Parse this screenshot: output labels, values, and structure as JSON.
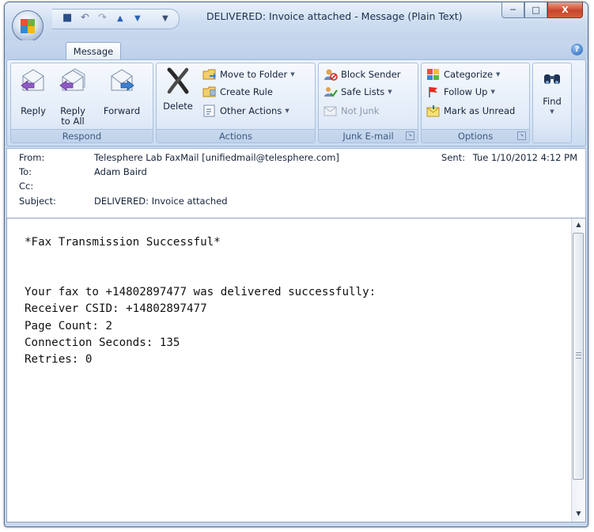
{
  "window": {
    "title": "DELIVERED: Invoice attached - Message (Plain Text)",
    "controls": {
      "minimize": "─",
      "maximize": "□",
      "close": "X"
    }
  },
  "quick_access": {
    "icons": [
      "save-icon",
      "undo-icon",
      "redo-icon",
      "previous-item-icon",
      "next-item-icon",
      "customize-icon"
    ]
  },
  "ribbon": {
    "active_tab": "Message",
    "groups": {
      "respond": {
        "label": "Respond",
        "reply": "Reply",
        "reply_all_line1": "Reply",
        "reply_all_line2": "to All",
        "forward": "Forward"
      },
      "actions": {
        "label": "Actions",
        "delete": "Delete",
        "move_to_folder": "Move to Folder",
        "create_rule": "Create Rule",
        "other_actions": "Other Actions"
      },
      "junk": {
        "label": "Junk E-mail",
        "block_sender": "Block Sender",
        "safe_lists": "Safe Lists",
        "not_junk": "Not Junk"
      },
      "options": {
        "label": "Options",
        "categorize": "Categorize",
        "follow_up": "Follow Up",
        "mark_as_unread": "Mark as Unread"
      },
      "find": {
        "label": "Find"
      }
    }
  },
  "header": {
    "from_label": "From:",
    "from_value": "Telesphere Lab FaxMail [unifiedmail@telesphere.com]",
    "to_label": "To:",
    "to_value": "Adam Baird",
    "cc_label": "Cc:",
    "cc_value": "",
    "subject_label": "Subject:",
    "subject_value": "DELIVERED: Invoice attached",
    "sent_label": "Sent:",
    "sent_value": "Tue 1/10/2012 4:12 PM"
  },
  "body": {
    "lines": [
      "*Fax Transmission Successful*",
      "",
      "",
      "Your fax to +14802897477 was delivered successfully:",
      "Receiver CSID: +14802897477",
      "Page Count: 2",
      "Connection Seconds: 135",
      "Retries: 0"
    ]
  },
  "colors": {
    "ribbon_bg": "#dae6f6",
    "title_text": "#1b2f4e",
    "close_button": "#c8462b",
    "link_red": "#c8462b"
  }
}
